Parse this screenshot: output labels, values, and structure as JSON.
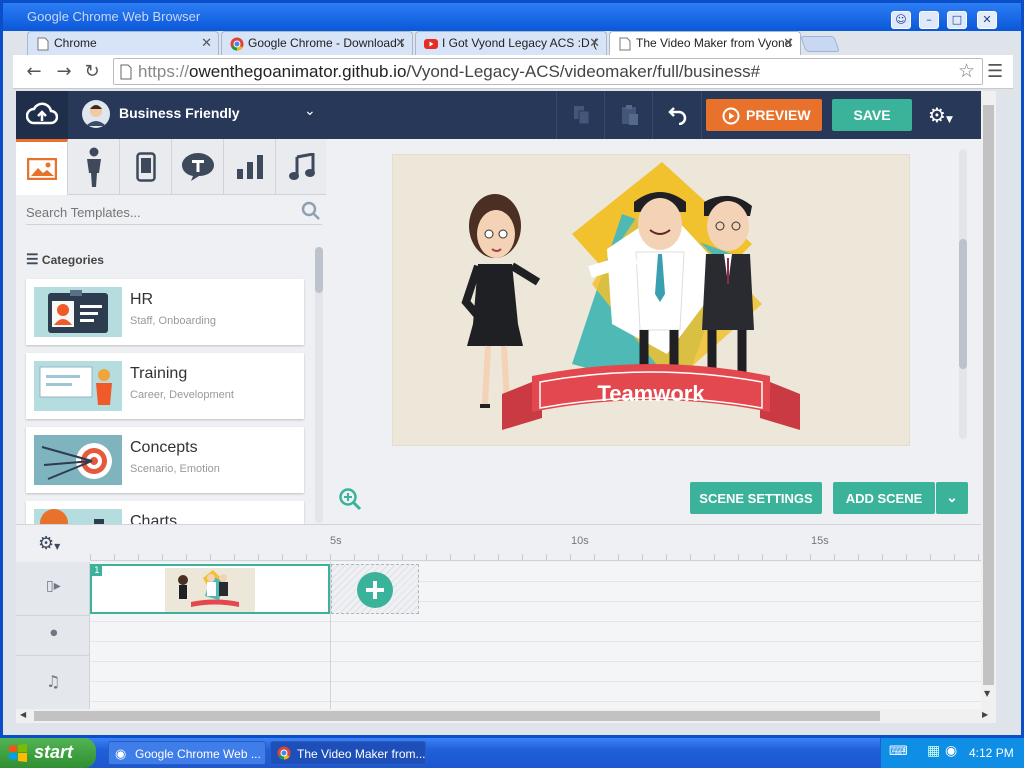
{
  "window": {
    "title": "Google Chrome Web Browser"
  },
  "tabs": [
    {
      "label": "Chrome",
      "icon": "page-icon"
    },
    {
      "label": "Google Chrome - Download t",
      "icon": "chrome-icon"
    },
    {
      "label": "I Got Vyond Legacy ACS :D (",
      "icon": "youtube-icon"
    },
    {
      "label": "The Video Maker from Vyond",
      "icon": "page-icon",
      "active": true
    }
  ],
  "toolbar": {
    "url_prefix": "https://",
    "url_host": "owenthegoanimator.github.io",
    "url_path": "/Vyond-Legacy-ACS/videomaker/full/business#"
  },
  "app": {
    "theme_name": "Business Friendly",
    "preview_label": "PREVIEW",
    "save_label": "SAVE",
    "search_placeholder": "Search Templates...",
    "categories_label": "Categories",
    "categories": [
      {
        "title": "HR",
        "subtitle": "Staff, Onboarding"
      },
      {
        "title": "Training",
        "subtitle": "Career, Development"
      },
      {
        "title": "Concepts",
        "subtitle": "Scenario, Emotion"
      },
      {
        "title": "Charts",
        "subtitle": ""
      }
    ],
    "scene_text": "Teamwork",
    "scene_settings_label": "SCENE SETTINGS",
    "add_scene_label": "ADD SCENE",
    "timeline": {
      "ticks": [
        "5s",
        "10s",
        "15s"
      ],
      "scene_number": "1"
    }
  },
  "taskbar": {
    "start_label": "start",
    "tasks": [
      "Google Chrome Web ...",
      "The Video Maker from..."
    ],
    "clock": "4:12 PM"
  },
  "colors": {
    "accent_orange": "#e8722b",
    "teal": "#3bb39a",
    "navy": "#273858"
  }
}
